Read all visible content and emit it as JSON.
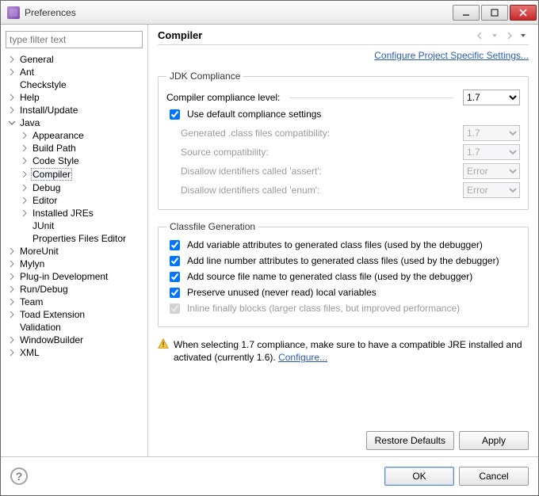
{
  "window": {
    "title": "Preferences"
  },
  "filter": {
    "placeholder": "type filter text"
  },
  "tree": {
    "n0": "General",
    "n1": "Ant",
    "n2": "Checkstyle",
    "n3": "Help",
    "n4": "Install/Update",
    "n5": "Java",
    "j0": "Appearance",
    "j1": "Build Path",
    "j2": "Code Style",
    "j3": "Compiler",
    "j4": "Debug",
    "j5": "Editor",
    "j6": "Installed JREs",
    "j7": "JUnit",
    "j8": "Properties Files Editor",
    "n6": "MoreUnit",
    "n7": "Mylyn",
    "n8": "Plug-in Development",
    "n9": "Run/Debug",
    "n10": "Team",
    "n11": "Toad Extension",
    "n12": "Validation",
    "n13": "WindowBuilder",
    "n14": "XML"
  },
  "pane": {
    "title": "Compiler",
    "configure_link": "Configure Project Specific Settings..."
  },
  "jdk": {
    "legend": "JDK Compliance",
    "compliance_label": "Compiler compliance level:",
    "compliance_value": "1.7",
    "use_default_label": "Use default compliance settings",
    "use_default": true,
    "gen_class_label": "Generated .class files compatibility:",
    "gen_class_value": "1.7",
    "src_compat_label": "Source compatibility:",
    "src_compat_value": "1.7",
    "assert_label": "Disallow identifiers called 'assert':",
    "assert_value": "Error",
    "enum_label": "Disallow identifiers called 'enum':",
    "enum_value": "Error"
  },
  "classfile": {
    "legend": "Classfile Generation",
    "c1_label": "Add variable attributes to generated class files (used by the debugger)",
    "c1": true,
    "c2_label": "Add line number attributes to generated class files (used by the debugger)",
    "c2": true,
    "c3_label": "Add source file name to generated class file (used by the debugger)",
    "c3": true,
    "c4_label": "Preserve unused (never read) local variables",
    "c4": true,
    "c5_label": "Inline finally blocks (larger class files, but improved performance)",
    "c5": true
  },
  "warning": {
    "text_a": "When selecting 1.7 compliance, make sure to have a compatible JRE installed and activated (currently 1.6). ",
    "link": "Configure..."
  },
  "buttons": {
    "restore": "Restore Defaults",
    "apply": "Apply",
    "ok": "OK",
    "cancel": "Cancel"
  }
}
